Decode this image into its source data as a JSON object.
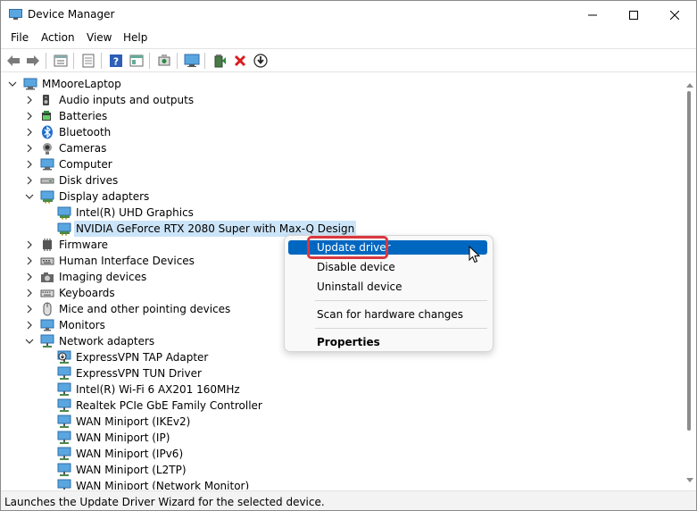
{
  "window": {
    "title": "Device Manager",
    "controls": [
      "minimize",
      "maximize",
      "close"
    ]
  },
  "menubar": {
    "items": [
      "File",
      "Action",
      "View",
      "Help"
    ]
  },
  "toolbar": {
    "buttons": [
      "back-arrow-icon",
      "forward-arrow-icon",
      "properties-icon",
      "document-icon",
      "help-icon",
      "view-icon",
      "scan-hardware-icon",
      "monitor-icon",
      "update-driver-icon",
      "uninstall-x-icon",
      "download-icon"
    ]
  },
  "tree": {
    "root": "MMooreLaptop",
    "rows": [
      {
        "label": "Audio inputs and outputs",
        "icon": "speaker-icon",
        "level": 1,
        "state": "collapsed"
      },
      {
        "label": "Batteries",
        "icon": "battery-icon",
        "level": 1,
        "state": "collapsed"
      },
      {
        "label": "Bluetooth",
        "icon": "bluetooth-icon",
        "level": 1,
        "state": "collapsed"
      },
      {
        "label": "Cameras",
        "icon": "camera-icon",
        "level": 1,
        "state": "collapsed"
      },
      {
        "label": "Computer",
        "icon": "computer-icon",
        "level": 1,
        "state": "collapsed"
      },
      {
        "label": "Disk drives",
        "icon": "disk-icon",
        "level": 1,
        "state": "collapsed"
      },
      {
        "label": "Display adapters",
        "icon": "display-adapter-icon",
        "level": 1,
        "state": "expanded"
      },
      {
        "label": "Intel(R) UHD Graphics",
        "icon": "display-adapter-icon",
        "level": 2,
        "state": "leaf"
      },
      {
        "label": "NVIDIA GeForce RTX 2080 Super with Max-Q Design",
        "icon": "display-adapter-icon",
        "level": 2,
        "state": "leaf",
        "selected": true
      },
      {
        "label": "Firmware",
        "icon": "chip-icon",
        "level": 1,
        "state": "collapsed"
      },
      {
        "label": "Human Interface Devices",
        "icon": "hid-icon",
        "level": 1,
        "state": "collapsed"
      },
      {
        "label": "Imaging devices",
        "icon": "imaging-icon",
        "level": 1,
        "state": "collapsed"
      },
      {
        "label": "Keyboards",
        "icon": "keyboard-icon",
        "level": 1,
        "state": "collapsed"
      },
      {
        "label": "Mice and other pointing devices",
        "icon": "mouse-icon",
        "level": 1,
        "state": "collapsed"
      },
      {
        "label": "Monitors",
        "icon": "monitor-icon",
        "level": 1,
        "state": "collapsed"
      },
      {
        "label": "Network adapters",
        "icon": "network-icon",
        "level": 1,
        "state": "expanded"
      },
      {
        "label": "ExpressVPN TAP Adapter",
        "icon": "network-download-icon",
        "level": 2,
        "state": "leaf"
      },
      {
        "label": "ExpressVPN TUN Driver",
        "icon": "network-icon",
        "level": 2,
        "state": "leaf"
      },
      {
        "label": "Intel(R) Wi-Fi 6 AX201 160MHz",
        "icon": "network-icon",
        "level": 2,
        "state": "leaf"
      },
      {
        "label": "Realtek PCIe GbE Family Controller",
        "icon": "network-icon",
        "level": 2,
        "state": "leaf"
      },
      {
        "label": "WAN Miniport (IKEv2)",
        "icon": "network-icon",
        "level": 2,
        "state": "leaf"
      },
      {
        "label": "WAN Miniport (IP)",
        "icon": "network-icon",
        "level": 2,
        "state": "leaf"
      },
      {
        "label": "WAN Miniport (IPv6)",
        "icon": "network-icon",
        "level": 2,
        "state": "leaf"
      },
      {
        "label": "WAN Miniport (L2TP)",
        "icon": "network-icon",
        "level": 2,
        "state": "leaf"
      },
      {
        "label": "WAN Miniport (Network Monitor)",
        "icon": "network-icon",
        "level": 2,
        "state": "leaf"
      }
    ]
  },
  "context_menu": {
    "items": [
      {
        "label": "Update driver",
        "highlighted": true
      },
      {
        "label": "Disable device"
      },
      {
        "label": "Uninstall device"
      },
      {
        "separator": true
      },
      {
        "label": "Scan for hardware changes"
      },
      {
        "separator": true
      },
      {
        "label": "Properties",
        "bold": true
      }
    ]
  },
  "statusbar": {
    "text": "Launches the Update Driver Wizard for the selected device."
  },
  "colors": {
    "accent": "#0067c0",
    "selection": "#cce4f7",
    "highlight_box": "#d9373f"
  }
}
